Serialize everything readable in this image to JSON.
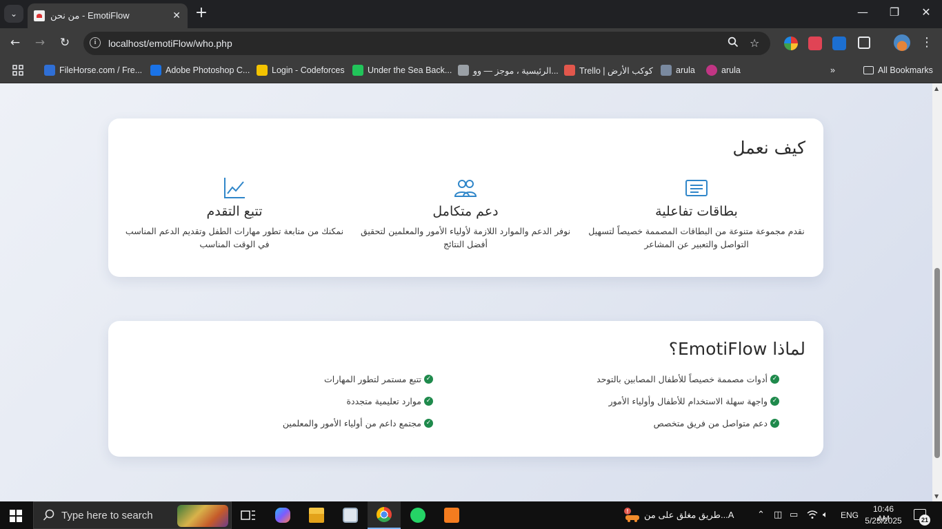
{
  "browser": {
    "tab_title": "من نحن - EmotiFlow",
    "url": "localhost/emotiFlow/who.php",
    "bookmarks": [
      {
        "label": "FileHorse.com / Fre...",
        "color": "#2f6fd6"
      },
      {
        "label": "Adobe Photoshop C...",
        "color": "#1a73e8"
      },
      {
        "label": "Login - Codeforces",
        "color": "#f3c300"
      },
      {
        "label": "Under the Sea Back...",
        "color": "#21c45a"
      },
      {
        "label": "الرئيسية ، موجز — وو...",
        "color": "#9aa0a6"
      },
      {
        "label": "Trello | كوكب الأرض",
        "color": "#e2574c"
      },
      {
        "label": "arula",
        "color": "#7a8aa0"
      },
      {
        "label": "arula",
        "color": "#c13584"
      }
    ],
    "all_bookmarks_label": "All Bookmarks"
  },
  "how_we_work": {
    "title": "كيف نعمل",
    "features": [
      {
        "icon": "cards-icon",
        "title": "بطاقات تفاعلية",
        "desc": "نقدم مجموعة متنوعة من البطاقات المصممة خصيصاً لتسهيل التواصل والتعبير عن المشاعر"
      },
      {
        "icon": "users-icon",
        "title": "دعم متكامل",
        "desc": "نوفر الدعم والموارد اللازمة لأولياء الأمور والمعلمين لتحقيق أفضل النتائج"
      },
      {
        "icon": "chart-line-icon",
        "title": "تتبع التقدم",
        "desc": "نمكنك من متابعة تطور مهارات الطفل وتقديم الدعم المناسب في الوقت المناسب"
      }
    ]
  },
  "why": {
    "title": "لماذا EmotiFlow؟",
    "col_right": [
      "أدوات مصممة خصيصاً للأطفال المصابين بالتوحد",
      "واجهة سهلة الاستخدام للأطفال وأولياء الأمور",
      "دعم متواصل من فريق متخصص"
    ],
    "col_left": [
      "تتبع مستمر لتطور المهارات",
      "موارد تعليمية متجددة",
      "مجتمع داعم من أولياء الأمور والمعلمين"
    ],
    "check_color": "#1f8a4c"
  },
  "taskbar": {
    "search_placeholder": "Type here to search",
    "news_text": "طريق مغلق على من...A",
    "lang": "ENG",
    "time": "10:46 AM",
    "date": "5/25/2025",
    "notif_count": "21"
  },
  "accent_color": "#2f86c9"
}
